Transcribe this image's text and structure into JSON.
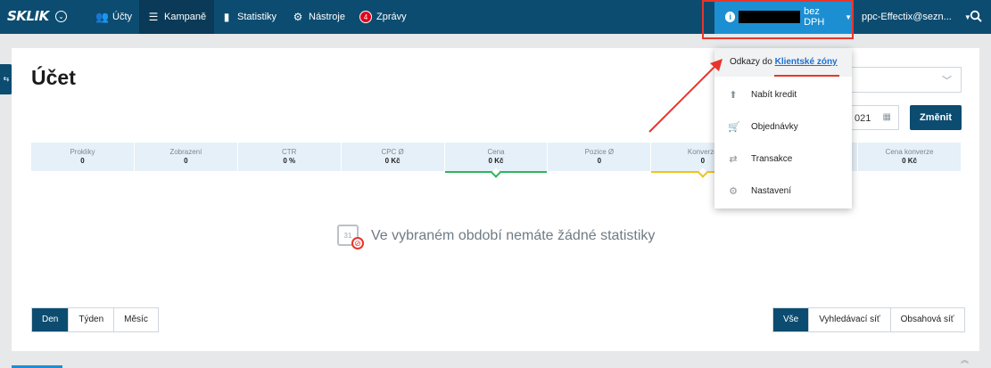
{
  "topbar": {
    "logo": "SKLIK",
    "nav": [
      {
        "label": "Účty",
        "icon": "users-icon"
      },
      {
        "label": "Kampaně",
        "icon": "menu-icon"
      },
      {
        "label": "Statistiky",
        "icon": "bar-chart-icon"
      },
      {
        "label": "Nástroje",
        "icon": "gear-icon"
      },
      {
        "label": "Zprávy",
        "icon": "badge",
        "badge": "4"
      }
    ],
    "account_suffix": "bez DPH",
    "user": "ppc-Effectix@sezn..."
  },
  "page": {
    "title": "Účet",
    "date_fragment": "021",
    "change_button": "Změnit"
  },
  "stats": [
    {
      "label": "Prokliky",
      "value": "0"
    },
    {
      "label": "Zobrazení",
      "value": "0"
    },
    {
      "label": "CTR",
      "value": "0 %"
    },
    {
      "label": "CPC Ø",
      "value": "0 Kč"
    },
    {
      "label": "Cena",
      "value": "0 Kč"
    },
    {
      "label": "Pozice Ø",
      "value": "0"
    },
    {
      "label": "Konverze",
      "value": "0"
    },
    {
      "label": "",
      "value": ""
    },
    {
      "label": "Cena konverze",
      "value": "0 Kč"
    }
  ],
  "empty_state": "Ve vybraném období nemáte žádné statistiky",
  "period": [
    "Den",
    "Týden",
    "Měsíc"
  ],
  "network": [
    "Vše",
    "Vyhledávací síť",
    "Obsahová síť"
  ],
  "dropdown": {
    "head_text": "Odkazy do ",
    "head_link": "Klientské zóny",
    "items": [
      {
        "label": "Nabít kredit",
        "icon": "arrow-up-icon"
      },
      {
        "label": "Objednávky",
        "icon": "cart-icon"
      },
      {
        "label": "Transakce",
        "icon": "transfer-icon"
      },
      {
        "label": "Nastavení",
        "icon": "gear-icon"
      }
    ]
  },
  "colors": {
    "topbar": "#0c4c70",
    "account": "#1c8fd3",
    "highlight": "#e8352b",
    "cena_line": "#2db55d",
    "konverze_line": "#f0c419"
  }
}
